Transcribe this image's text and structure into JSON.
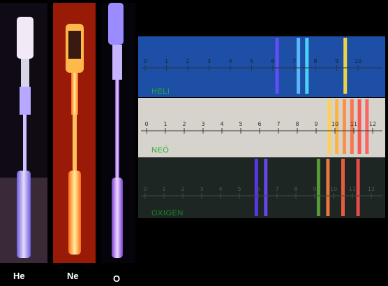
{
  "tubes": [
    {
      "id": "he",
      "label": "He",
      "glow": "#b9a4ff",
      "bg": "#0f0a14"
    },
    {
      "id": "ne",
      "label": "Ne",
      "glow": "#ffb03a",
      "bg": "#9a1a08"
    },
    {
      "id": "o",
      "label": "O",
      "glow": "#c79bff",
      "bg": "#05040a"
    }
  ],
  "spectra": [
    {
      "id": "he",
      "name": "HELI",
      "ticks": [
        "0",
        "1",
        "2",
        "3",
        "4",
        "5",
        "6",
        "7",
        "8",
        "9",
        "10"
      ],
      "lines": [
        {
          "pos": 6.2,
          "color": "#6a4cff"
        },
        {
          "pos": 7.2,
          "color": "#5fc4ff"
        },
        {
          "pos": 7.6,
          "color": "#4fe0ff"
        },
        {
          "pos": 9.4,
          "color": "#ffe23a"
        }
      ]
    },
    {
      "id": "ne",
      "name": "NEÓ",
      "ticks": [
        "0",
        "1",
        "2",
        "3",
        "4",
        "5",
        "6",
        "7",
        "8",
        "9",
        "10",
        "11",
        "12"
      ],
      "lines": [
        {
          "pos": 9.7,
          "color": "#ffd24a"
        },
        {
          "pos": 10.1,
          "color": "#ffb030"
        },
        {
          "pos": 10.5,
          "color": "#ff8a3a"
        },
        {
          "pos": 10.9,
          "color": "#ff6a40"
        },
        {
          "pos": 11.3,
          "color": "#ff4a48"
        },
        {
          "pos": 11.7,
          "color": "#ff5a5a"
        }
      ]
    },
    {
      "id": "o",
      "name": "OXIGEN",
      "ticks": [
        "0",
        "1",
        "2",
        "3",
        "4",
        "5",
        "6",
        "7",
        "8",
        "9",
        "10",
        "11",
        "12"
      ],
      "lines": [
        {
          "pos": 5.9,
          "color": "#5c3aff"
        },
        {
          "pos": 6.4,
          "color": "#6e4aff"
        },
        {
          "pos": 9.2,
          "color": "#5fa838"
        },
        {
          "pos": 9.7,
          "color": "#ff8040"
        },
        {
          "pos": 10.5,
          "color": "#ff6040"
        },
        {
          "pos": 11.3,
          "color": "#ff5050"
        }
      ]
    }
  ]
}
